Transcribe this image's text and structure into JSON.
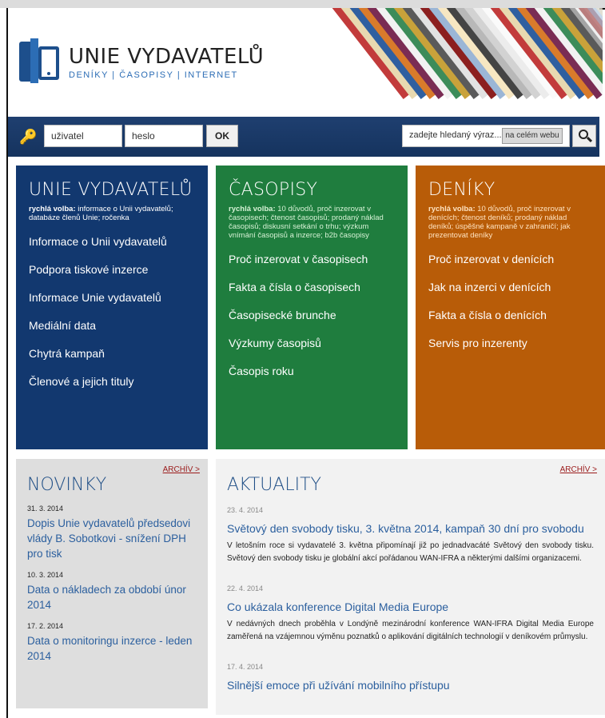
{
  "brand": {
    "title": "UNIE VYDAVATELŮ",
    "subtitle": "DENÍKY | ČASOPISY | INTERNET"
  },
  "login": {
    "user_value": "uživatel",
    "pass_value": "heslo",
    "ok_label": "OK",
    "search_placeholder": "zadejte hledaný výraz...",
    "scope_label": "na celém webu"
  },
  "columns": {
    "unie": {
      "heading": "UNIE VYDAVATELŮ",
      "quick_label": "rychlá volba:",
      "quick_text": " informace o Unii vydavatelů; databáze členů Unie; ročenka",
      "links": [
        "Informace o Unii vydavatelů",
        "Podpora tiskové inzerce",
        "Informace Unie vydavatelů",
        "Mediální data",
        "Chytrá kampaň",
        "Členové a jejich tituly"
      ]
    },
    "casopisy": {
      "heading": "ČASOPISY",
      "quick_label": "rychlá volba:",
      "quick_text": " 10 důvodů, proč inzerovat v časopisech; čtenost časopisů; prodaný náklad časopisů; diskusní setkání o trhu; výzkum vnímání časopisů a inzerce; b2b časopisy",
      "links": [
        "Proč inzerovat v časopisech",
        "Fakta a čísla o časopisech",
        "Časopisecké brunche",
        "Výzkumy časopisů",
        "Časopis roku"
      ]
    },
    "deniky": {
      "heading": "DENÍKY",
      "quick_label": "rychlá volba:",
      "quick_text": " 10 důvodů, proč inzerovat v denících; čtenost deníků; prodaný náklad deníků; úspěšné kampaně v zahraničí; jak prezentovat deníky",
      "links": [
        "Proč inzerovat v denících",
        "Jak na inzerci v denících",
        "Fakta a čísla o denících",
        "Servis pro inzerenty"
      ]
    }
  },
  "novinky": {
    "heading": "NOVINKY",
    "archive_label": "ARCHÍV >",
    "items": [
      {
        "date": "31. 3. 2014",
        "title": "Dopis Unie vydavatelů předsedovi vlády B. Sobotkovi - snížení DPH pro tisk"
      },
      {
        "date": "10. 3. 2014",
        "title": "Data o nákladech za období únor 2014"
      },
      {
        "date": "17. 2. 2014",
        "title": "Data o monitoringu inzerce - leden 2014"
      }
    ]
  },
  "aktuality": {
    "heading": "AKTUALITY",
    "archive_label": "ARCHÍV >",
    "items": [
      {
        "date": "23. 4. 2014",
        "title": "Světový den svobody tisku, 3. května 2014, kampaň 30 dní pro svobodu",
        "text": "V letošním roce si vydavatelé 3. května připomínají již po jednadvacáté Světový den svobody tisku. Světový den svobody tisku je globální akcí pořádanou WAN-IFRA a některými dalšími organizacemi."
      },
      {
        "date": "22. 4. 2014",
        "title": "Co ukázala konference Digital Media Europe",
        "text": "V nedávných dnech proběhla v Londýně mezinárodní konference WAN-IFRA Digital Media Europe zaměřená na vzájemnou výměnu poznatků o aplikování digitálních technologií v deníkovém průmyslu."
      },
      {
        "date": "17. 4. 2014",
        "title": "Silnější emoce při užívání mobilního přístupu",
        "text": ""
      }
    ]
  },
  "colors": {
    "blue": "#12386f",
    "green": "#1f7d3e",
    "orange": "#b85c08",
    "bar": "#1f3f70",
    "link": "#2b5f9e"
  },
  "icons": [
    "key-icon",
    "search-icon",
    "logo-book-icon"
  ]
}
